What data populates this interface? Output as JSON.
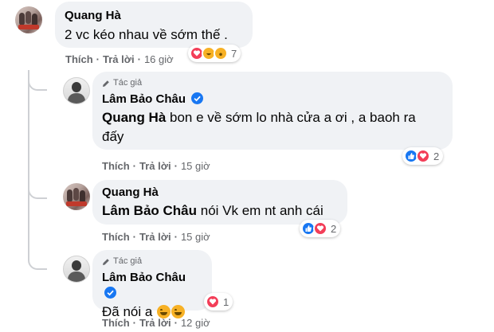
{
  "comments": [
    {
      "author": "Quang Hà",
      "text": "2 vc kéo nhau về sớm thế .",
      "actions": {
        "like": "Thích",
        "reply": "Trả lời",
        "time": "16 giờ"
      },
      "reactions": {
        "icons": [
          "love",
          "haha",
          "wow"
        ],
        "count": "7"
      }
    },
    {
      "badge": "Tác giả",
      "author": "Lâm Bảo Châu",
      "mention": "Quang Hà",
      "text_line1": " bon e về sớm lo nhà cửa a ơi , a baoh ra",
      "text_line2": "đấy",
      "actions": {
        "like": "Thích",
        "reply": "Trả lời",
        "time": "15 giờ"
      },
      "reactions": {
        "icons": [
          "like",
          "love"
        ],
        "count": "2"
      }
    },
    {
      "author": "Quang Hà",
      "mention": "Lâm Bảo Châu",
      "text": " nói Vk em nt anh cái",
      "actions": {
        "like": "Thích",
        "reply": "Trả lời",
        "time": "15 giờ"
      },
      "reactions": {
        "icons": [
          "like",
          "love"
        ],
        "count": "2"
      }
    },
    {
      "badge": "Tác giả",
      "author": "Lâm Bảo Châu",
      "text": "Đã nói a",
      "actions": {
        "like": "Thích",
        "reply": "Trả lời",
        "time": "12 giờ"
      },
      "reactions": {
        "icons": [
          "love"
        ],
        "count": "1"
      }
    }
  ],
  "colors": {
    "bubble": "#f0f2f5",
    "meta": "#65676b",
    "verified": "#1877f2",
    "love": "#f33e58",
    "like": "#1877f2",
    "haha": "#f7b125"
  }
}
